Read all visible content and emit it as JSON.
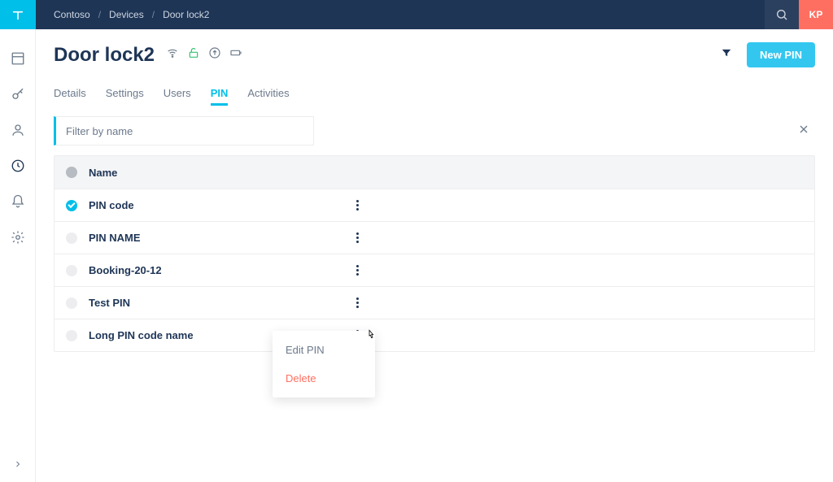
{
  "breadcrumb": {
    "a": "Contoso",
    "b": "Devices",
    "c": "Door lock2"
  },
  "avatar": "KP",
  "page": {
    "title": "Door lock2"
  },
  "actions": {
    "new_pin": "New PIN"
  },
  "tabs": {
    "details": "Details",
    "settings": "Settings",
    "users": "Users",
    "pin": "PIN",
    "activities": "Activities"
  },
  "filter": {
    "placeholder": "Filter by name"
  },
  "table": {
    "header": {
      "name": "Name"
    },
    "rows": [
      {
        "name": "PIN code",
        "active": true
      },
      {
        "name": "PIN NAME",
        "active": false
      },
      {
        "name": "Booking-20-12",
        "active": false
      },
      {
        "name": "Test PIN",
        "active": false
      },
      {
        "name": "Long PIN code name",
        "active": false
      }
    ]
  },
  "menu": {
    "edit": "Edit PIN",
    "delete": "Delete"
  }
}
